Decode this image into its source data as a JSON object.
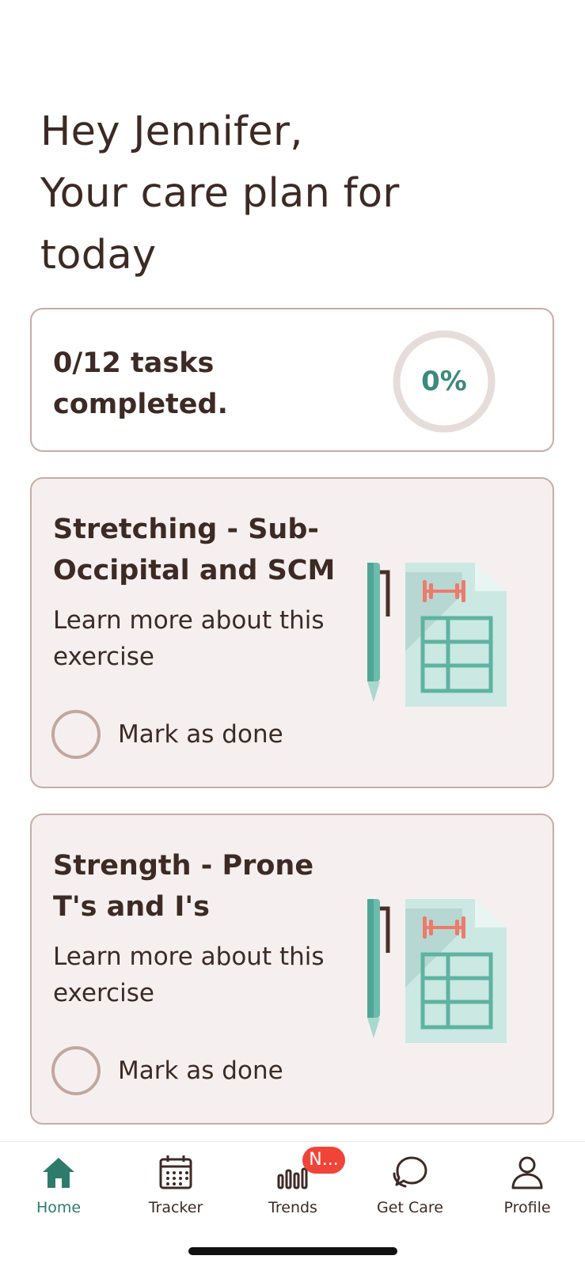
{
  "greeting": {
    "line1": "Hey Jennifer,",
    "line2": "Your care plan for",
    "line3": "today"
  },
  "summary": {
    "line1": "0/12 tasks",
    "line2": "completed.",
    "progress_label": "0%",
    "progress_fraction": 0
  },
  "tasks": [
    {
      "title_line1": "Stretching - Sub-",
      "title_line2": "Occipital and SCM",
      "link_line1": "Learn more about this",
      "link_line2": "exercise",
      "mark_label": "Mark as done",
      "done": false,
      "illustration_icon": "exercise-plan-illustration"
    },
    {
      "title_line1": "Strength - Prone",
      "title_line2": "T's and I's",
      "link_line1": "Learn more about this",
      "link_line2": "exercise",
      "mark_label": "Mark as done",
      "done": false,
      "illustration_icon": "exercise-plan-illustration"
    }
  ],
  "tabbar": {
    "items": [
      {
        "label": "Home",
        "icon": "home-icon",
        "active": true
      },
      {
        "label": "Tracker",
        "icon": "calendar-icon",
        "active": false
      },
      {
        "label": "Trends",
        "icon": "bar-chart-icon",
        "active": false,
        "badge": "N..."
      },
      {
        "label": "Get Care",
        "icon": "chat-icon",
        "active": false
      },
      {
        "label": "Profile",
        "icon": "person-icon",
        "active": false
      }
    ]
  },
  "colors": {
    "accent": "#2e7b6c",
    "text": "#3d2a24",
    "card_border": "#c9aca4",
    "card_bg": "#f5f0ef",
    "badge": "#f04438",
    "ring_track": "#e6dcd9"
  }
}
